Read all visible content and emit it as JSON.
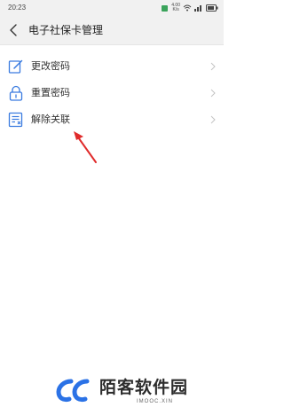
{
  "status_bar": {
    "time": "20:23",
    "network_speed_value": "4.00",
    "network_speed_unit": "K/s",
    "icons": [
      "sim-icon",
      "wifi-icon",
      "signal-icon",
      "battery-icon"
    ]
  },
  "header": {
    "title": "电子社保卡管理"
  },
  "menu": {
    "items": [
      {
        "label": "更改密码",
        "icon": "edit-icon"
      },
      {
        "label": "重置密码",
        "icon": "lock-icon"
      },
      {
        "label": "解除关联",
        "icon": "unlink-document-icon"
      }
    ]
  },
  "annotation": {
    "color": "#e02b2b"
  },
  "watermark": {
    "text": "陌客软件园",
    "subtext": "IMOOC.XIN",
    "color": "#2b72e6"
  },
  "colors": {
    "icon_blue": "#3a7be0",
    "header_bg": "#f1f1f1"
  }
}
